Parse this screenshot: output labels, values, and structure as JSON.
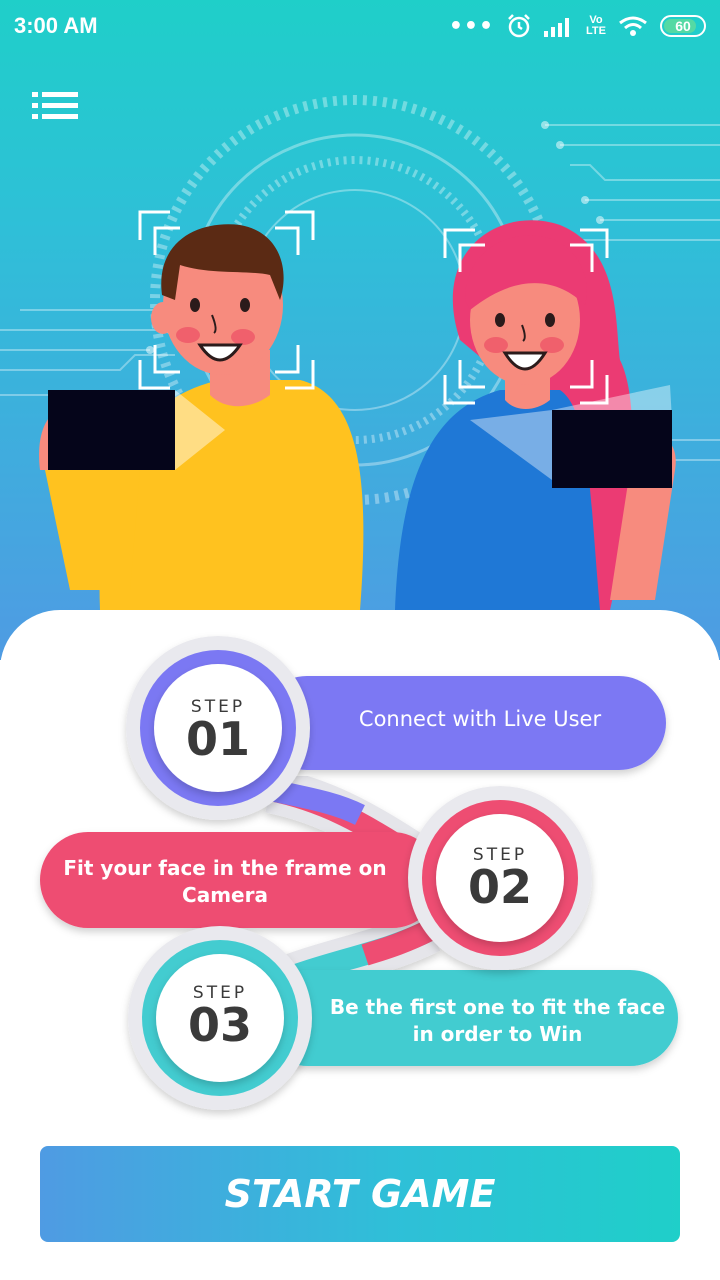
{
  "status_bar": {
    "time": "3:00 AM",
    "lte_label": "Vo\nLTE",
    "battery": "60",
    "icons": [
      "more-dots-icon",
      "alarm-icon",
      "signal-icon",
      "wifi-icon",
      "battery-icon"
    ]
  },
  "header": {
    "menu_icon": "menu-icon"
  },
  "steps": [
    {
      "word": "STEP",
      "number": "01",
      "text": "Connect with Live User",
      "color": "#7b78f3"
    },
    {
      "word": "STEP",
      "number": "02",
      "text": "Fit your face in the frame on Camera",
      "color": "#ee4d72"
    },
    {
      "word": "STEP",
      "number": "03",
      "text": "Be the first one to fit the face in order to Win",
      "color": "#43ccd0"
    }
  ],
  "start_button": {
    "label": "START GAME"
  },
  "colors": {
    "teal": "#1fcfc9",
    "blue": "#4f9be3",
    "purple": "#7b78f3",
    "pink": "#ee4d72",
    "cyan": "#43ccd0"
  }
}
